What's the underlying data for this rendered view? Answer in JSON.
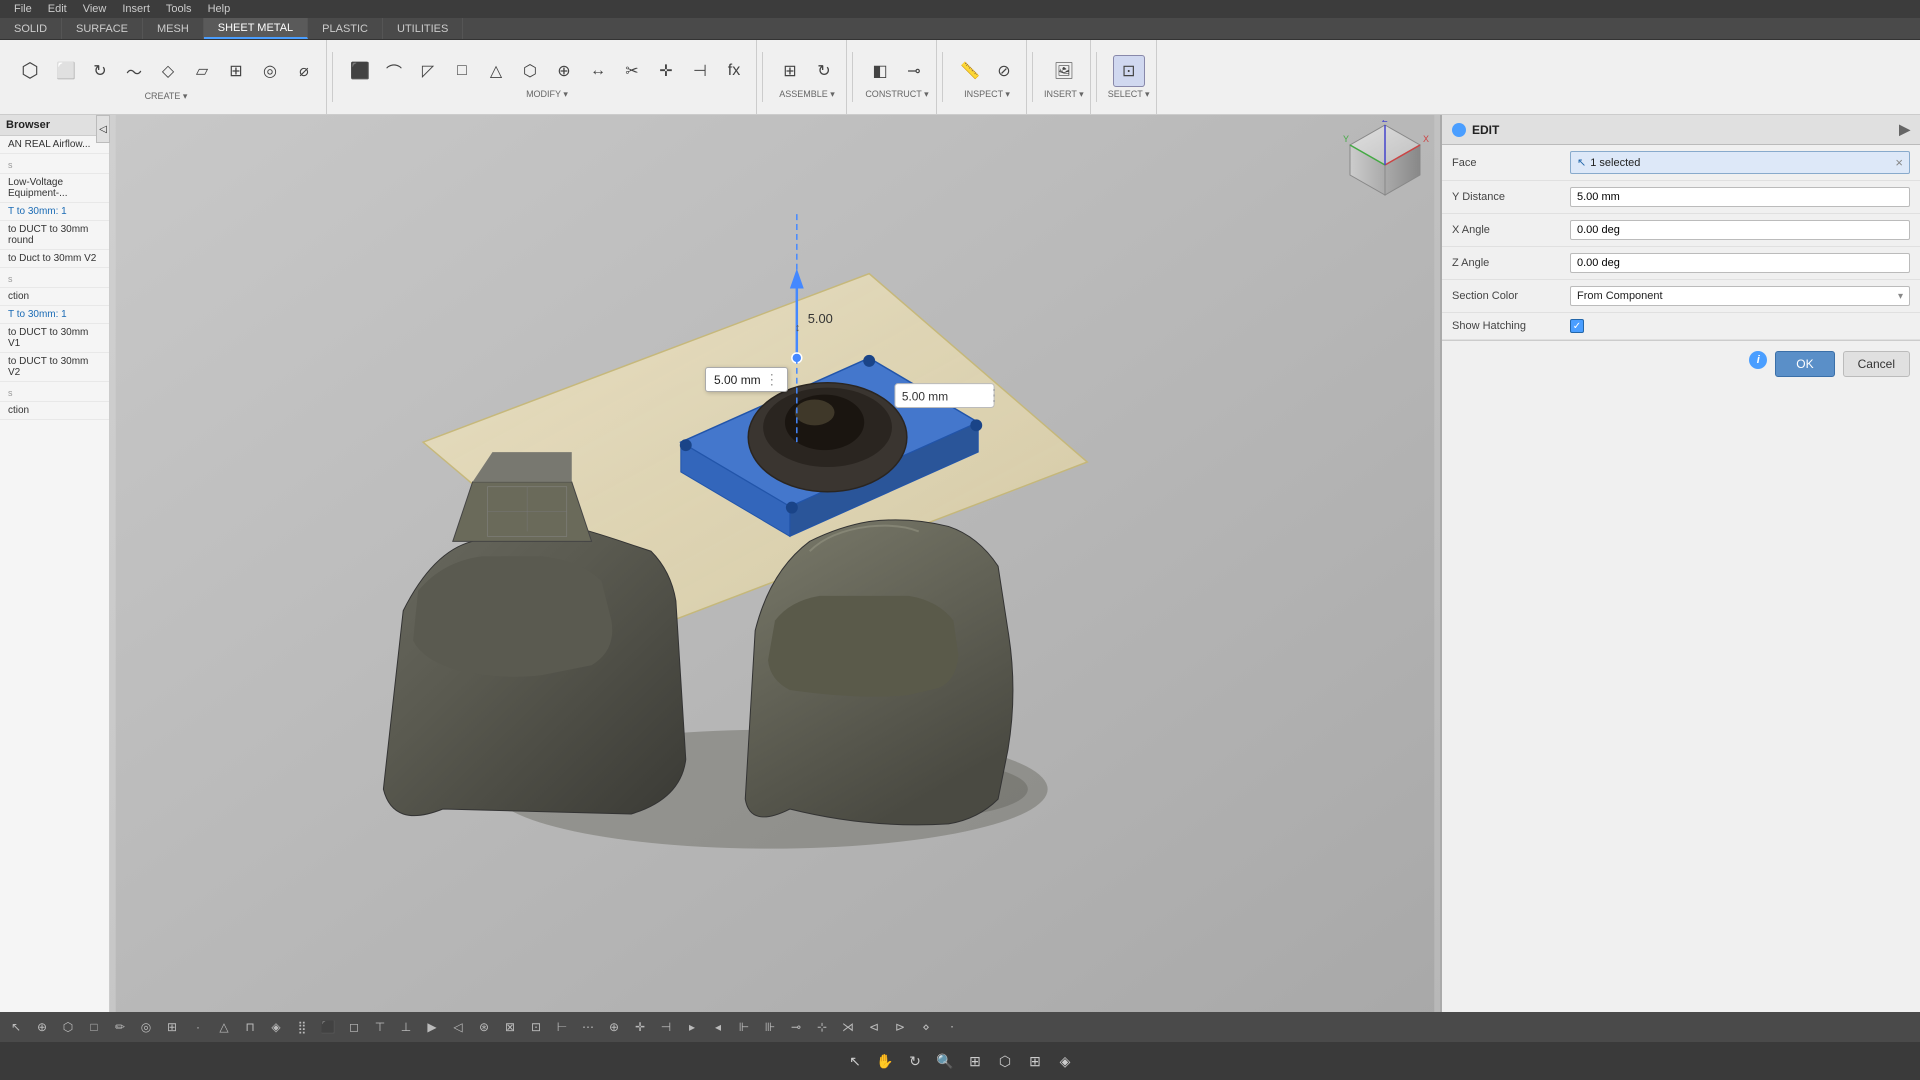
{
  "topMenu": {
    "items": [
      "File",
      "Edit",
      "View",
      "Insert",
      "Tools",
      "Help"
    ]
  },
  "toolbarTabs": {
    "tabs": [
      "SOLID",
      "SURFACE",
      "MESH",
      "SHEET METAL",
      "PLASTIC",
      "UTILITIES"
    ]
  },
  "toolbarGroups": {
    "create": {
      "label": "CREATE ▾"
    },
    "modify": {
      "label": "MODIFY ▾"
    },
    "assemble": {
      "label": "ASSEMBLE ▾"
    },
    "construct": {
      "label": "CONSTRUCT ▾"
    },
    "inspect": {
      "label": "INSPECT ▾"
    },
    "insert": {
      "label": "INSERT ▾"
    },
    "select": {
      "label": "SELECT ▾"
    }
  },
  "leftPanel": {
    "header": "Browser",
    "items": [
      {
        "text": "AN REAL Airflow...",
        "type": "header"
      },
      {
        "text": "s",
        "type": "section"
      },
      {
        "text": "Low-Voltage Equipment-...",
        "type": "item"
      },
      {
        "text": "T to 30mm: 1",
        "type": "item",
        "highlight": true
      },
      {
        "text": "",
        "type": "separator"
      },
      {
        "text": "to DUCT to 30mm round",
        "type": "item"
      },
      {
        "text": "to Duct to 30mm V2",
        "type": "item"
      },
      {
        "text": "s",
        "type": "section"
      },
      {
        "text": "ction",
        "type": "item"
      },
      {
        "text": "T to 30mm: 1",
        "type": "item",
        "highlight": true
      },
      {
        "text": "",
        "type": "separator"
      },
      {
        "text": "to DUCT to 30mm V1",
        "type": "item"
      },
      {
        "text": "to DUCT to 30mm V2",
        "type": "item"
      },
      {
        "text": "s",
        "type": "section"
      },
      {
        "text": "ction",
        "type": "item"
      }
    ]
  },
  "rightPanel": {
    "title": "EDIT",
    "fields": {
      "face": {
        "label": "Face",
        "value": "1 selected"
      },
      "yDistance": {
        "label": "Y Distance",
        "value": "5.00 mm"
      },
      "xAngle": {
        "label": "X Angle",
        "value": "0.00 deg"
      },
      "zAngle": {
        "label": "Z Angle",
        "value": "0.00 deg"
      },
      "sectionColor": {
        "label": "Section Color",
        "value": "From Component"
      },
      "showHatching": {
        "label": "Show Hatching",
        "checked": true
      }
    },
    "buttons": {
      "ok": "OK",
      "cancel": "Cancel"
    }
  },
  "tooltip": {
    "value": "5.00 mm"
  },
  "yIndicator": {
    "value": "5.00"
  },
  "constructLabel": "CONSTRUCT `",
  "selectedLabel": "selected",
  "sheetMetalLabel": "SHEET METAL"
}
